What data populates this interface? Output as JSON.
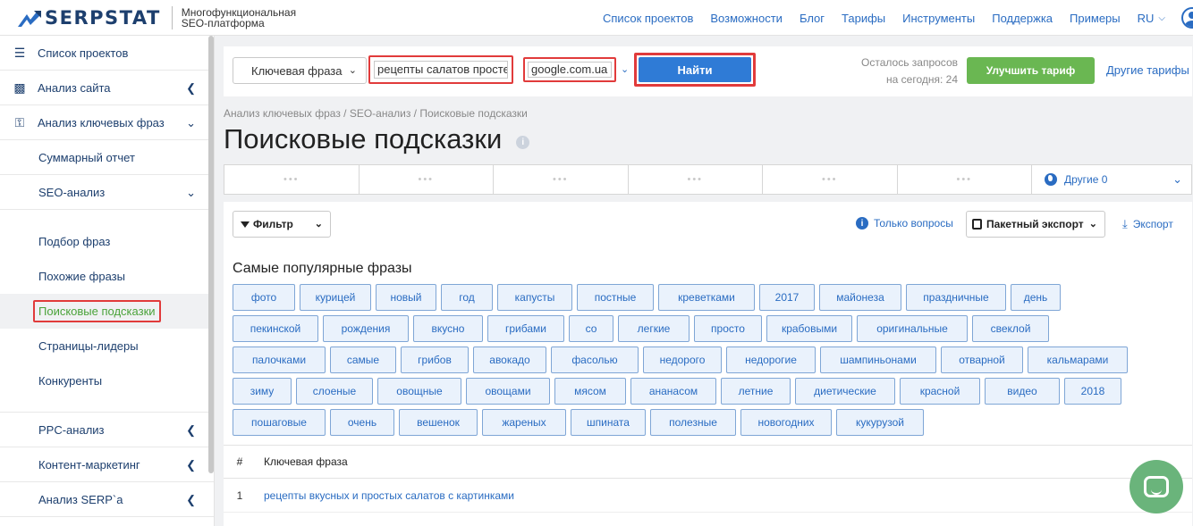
{
  "header": {
    "brand": "SERPSTAT",
    "tagline_line1": "Многофункциональная",
    "tagline_line2": "SEO-платформа",
    "nav": [
      "Список проектов",
      "Возможности",
      "Блог",
      "Тарифы",
      "Инструменты",
      "Поддержка",
      "Примеры"
    ],
    "lang": "RU"
  },
  "sidebar": {
    "items": [
      {
        "label": "Список проектов",
        "icon": "menu-icon"
      },
      {
        "label": "Анализ сайта",
        "icon": "chart-icon"
      },
      {
        "label": "Анализ ключевых фраз",
        "icon": "key-icon"
      }
    ],
    "summary": "Суммарный отчет",
    "seo": "SEO-анализ",
    "sub": [
      "Подбор фраз",
      "Похожие фразы",
      "Поисковые подсказки",
      "Страницы-лидеры",
      "Конкуренты"
    ],
    "bottom": [
      "PPC-анализ",
      "Контент-маркетинг",
      "Анализ SERP`a"
    ]
  },
  "search": {
    "type": "Ключевая фраза",
    "query": "рецепты салатов просте",
    "database": "google.com.ua",
    "find": "Найти",
    "remaining_line1": "Осталось запросов",
    "remaining_line2": "на сегодня: 24",
    "upgrade": "Улучшить тариф",
    "other_plans": "Другие тарифы"
  },
  "breadcrumb": "Анализ ключевых фраз / SEO-анализ / Поисковые подсказки",
  "title": "Поисковые подсказки",
  "tabs": {
    "loading": "•••",
    "other": "Другие 0"
  },
  "toolbar": {
    "filter": "Фильтр",
    "only_questions": "Только вопросы",
    "batch_export": "Пакетный экспорт",
    "export": "Экспорт"
  },
  "popular": {
    "title": "Самые популярные фразы",
    "rows": [
      [
        "фото",
        "курицей",
        "новый",
        "год",
        "капусты",
        "постные",
        "креветками",
        "2017",
        "майонеза",
        "праздничные",
        "день"
      ],
      [
        "пекинской",
        "рождения",
        "вкусно",
        "грибами",
        "со",
        "легкие",
        "просто",
        "крабовыми",
        "оригинальные",
        "свеклой"
      ],
      [
        "палочками",
        "самые",
        "грибов",
        "авокадо",
        "фасолью",
        "недорого",
        "недорогие",
        "шампиньонами",
        "отварной",
        "кальмарами"
      ],
      [
        "зиму",
        "слоеные",
        "овощные",
        "овощами",
        "мясом",
        "ананасом",
        "летние",
        "диетические",
        "красной",
        "видео",
        "2018"
      ],
      [
        "пошаговые",
        "очень",
        "вешенок",
        "жареных",
        "шпината",
        "полезные",
        "новогодних",
        "кукурузой"
      ]
    ]
  },
  "table": {
    "col_num": "#",
    "col_kw": "Ключевая фраза",
    "rows": [
      {
        "num": "1",
        "kw": "рецепты вкусных и простых салатов с картинками"
      }
    ]
  }
}
